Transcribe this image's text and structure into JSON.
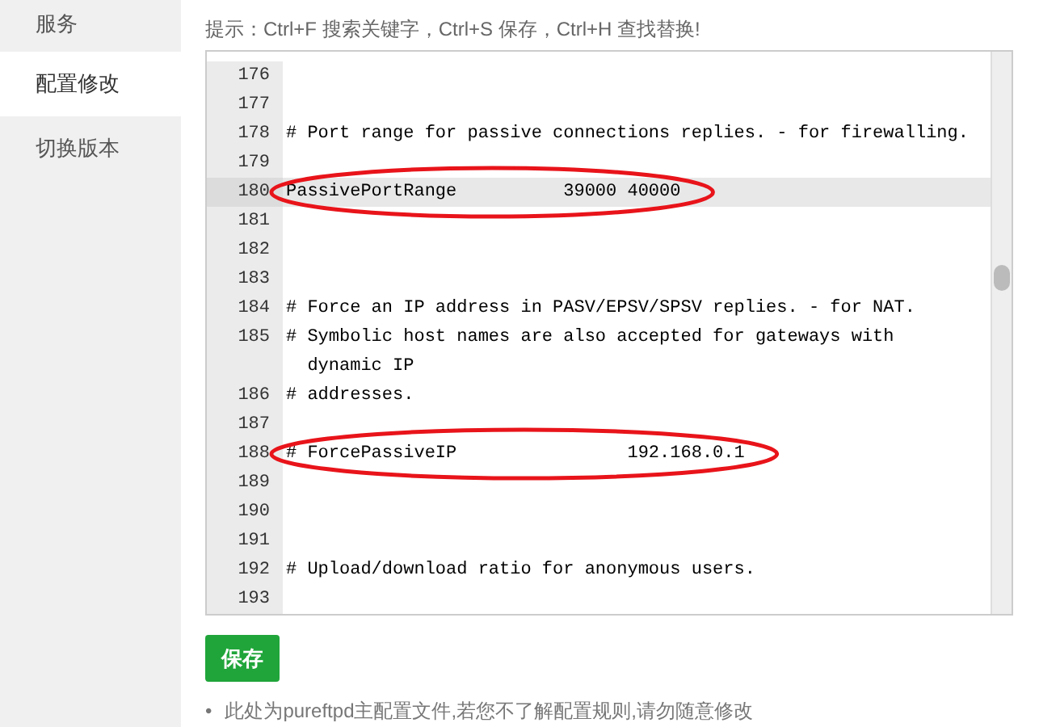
{
  "sidebar": {
    "items": [
      {
        "label": "服务",
        "selected": false
      },
      {
        "label": "配置修改",
        "selected": true
      },
      {
        "label": "切换版本",
        "selected": false
      }
    ]
  },
  "hint": "提示：Ctrl+F 搜索关键字，Ctrl+S 保存，Ctrl+H 查找替换!",
  "editor": {
    "lines": [
      {
        "number": "176",
        "active": false,
        "circled": false
      },
      {
        "number": "177",
        "active": false,
        "circled": false
      },
      {
        "number": "178",
        "text": "# Port range for passive connections replies. - for firewalling.",
        "active": false,
        "circled": false
      },
      {
        "number": "179",
        "active": false,
        "circled": false
      },
      {
        "number": "180",
        "text": "PassivePortRange          39000 40000",
        "active": true,
        "circled": true
      },
      {
        "number": "181",
        "active": false,
        "circled": false
      },
      {
        "number": "182",
        "active": false,
        "circled": false
      },
      {
        "number": "183",
        "active": false,
        "circled": false
      },
      {
        "number": "184",
        "text": "# Force an IP address in PASV/EPSV/SPSV replies. - for NAT.",
        "active": false,
        "circled": false
      },
      {
        "number": "185",
        "text": "# Symbolic host names are also accepted for gateways with dynamic IP",
        "active": false,
        "circled": false
      },
      {
        "number": "186",
        "text": "# addresses.",
        "active": false,
        "circled": false
      },
      {
        "number": "187",
        "active": false,
        "circled": false
      },
      {
        "number": "188",
        "text": "# ForcePassiveIP                192.168.0.1",
        "active": false,
        "circled": true
      },
      {
        "number": "189",
        "active": false,
        "circled": false
      },
      {
        "number": "190",
        "active": false,
        "circled": false
      },
      {
        "number": "191",
        "active": false,
        "circled": false
      },
      {
        "number": "192",
        "text": "# Upload/download ratio for anonymous users.",
        "active": false,
        "circled": false
      },
      {
        "number": "193",
        "active": false,
        "circled": false
      }
    ]
  },
  "save_button": "保存",
  "notes": [
    {
      "marker": "•",
      "text": "此处为pureftpd主配置文件,若您不了解配置规则,请勿随意修改"
    }
  ]
}
